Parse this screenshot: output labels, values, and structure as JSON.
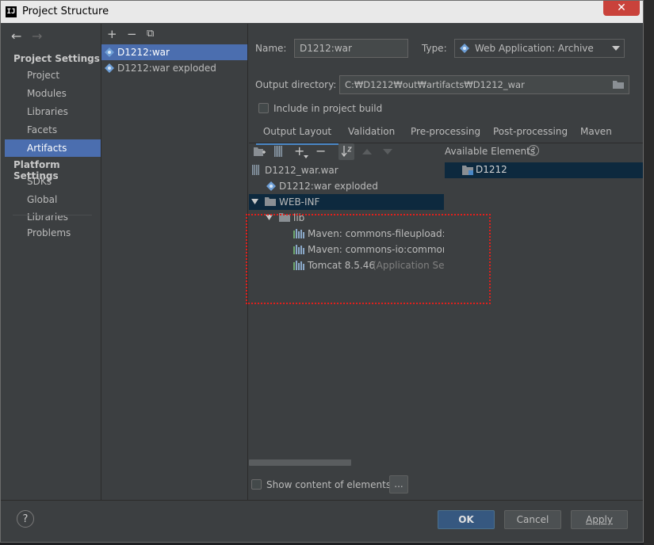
{
  "window": {
    "title": "Project Structure",
    "logo": "IJ",
    "close_glyph": "✕"
  },
  "leftnav": {
    "back_glyph": "←",
    "forward_glyph": "→",
    "project_settings_heading": "Project Settings",
    "platform_settings_heading": "Platform Settings",
    "items": [
      "Project",
      "Modules",
      "Libraries",
      "Facets",
      "Artifacts"
    ],
    "platform_items": [
      "SDKs",
      "Global Libraries"
    ],
    "problems": "Problems"
  },
  "artifacts": {
    "toolbar": {
      "add": "+",
      "remove": "−",
      "copy": "⧉"
    },
    "items": [
      "D1212:war",
      "D1212:war exploded"
    ]
  },
  "config": {
    "name_label": "Name:",
    "name_value": "D1212:war",
    "type_label": "Type:",
    "type_value": "Web Application: Archive",
    "output_dir_label": "Output directory:",
    "output_dir_value": "C:₩D1212₩out₩artifacts₩D1212_war",
    "include_build_label": "Include in project build",
    "tabs": [
      "Output Layout",
      "Validation",
      "Pre-processing",
      "Post-processing",
      "Maven"
    ],
    "available_label": "Available Elements",
    "help_glyph": "?",
    "available_items": [
      "D1212"
    ],
    "tree": {
      "root": "D1212_war.war",
      "exploded": "D1212:war exploded",
      "webinf": "WEB-INF",
      "lib": "lib",
      "libs": [
        {
          "name": "Maven: commons-fileupload:co",
          "note": ""
        },
        {
          "name": "Maven: commons-io:commons-",
          "note": ""
        },
        {
          "name": "Tomcat 8.5.46",
          "note": "(Application Serv"
        }
      ]
    },
    "show_content_label": "Show content of elements",
    "ellipsis": "..."
  },
  "footer": {
    "help": "?",
    "ok": "OK",
    "cancel": "Cancel",
    "apply": "Apply"
  },
  "colors": {
    "accent": "#4b6eaf",
    "selection_dark": "#0d293e",
    "highlight_box": "#e0201c",
    "panel": "#3c3f41"
  }
}
